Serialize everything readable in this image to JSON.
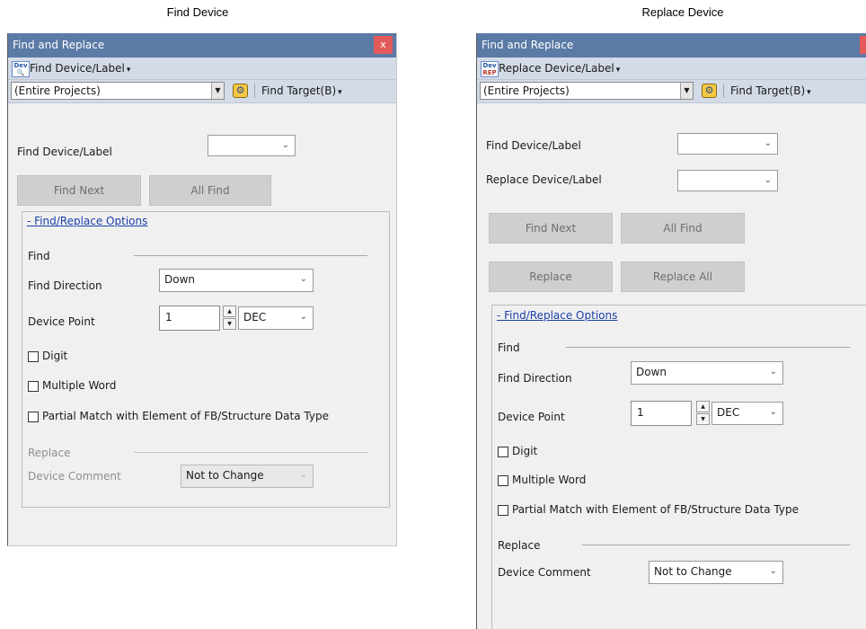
{
  "captions": {
    "left": "Find Device",
    "right": "Replace Device"
  },
  "find_panel": {
    "title": "Find and Replace",
    "close_label": "x",
    "mode_label": "Find Device/Label",
    "scope_value": "(Entire Projects)",
    "target_label": "Find Target(B)",
    "find_field_label": "Find Device/Label",
    "find_field_value": "",
    "find_next_label": "Find Next",
    "all_find_label": "All Find",
    "options_link": "- Find/Replace Options",
    "find_section": "Find",
    "direction_label": "Find Direction",
    "direction_value": "Down",
    "device_point_label": "Device Point",
    "device_point_value": "1",
    "radix_value": "DEC",
    "digit_label": "Digit",
    "multiple_word_label": "Multiple Word",
    "partial_match_label": "Partial Match with Element of FB/Structure Data Type",
    "replace_section": "Replace",
    "device_comment_label": "Device Comment",
    "device_comment_value": "Not to Change"
  },
  "replace_panel": {
    "title": "Find and Replace",
    "mode_label": "Replace Device/Label",
    "scope_value": "(Entire Projects)",
    "target_label": "Find Target(B)",
    "find_field_label": "Find Device/Label",
    "find_field_value": "",
    "replace_field_label": "Replace Device/Label",
    "replace_field_value": "",
    "find_next_label": "Find Next",
    "all_find_label": "All Find",
    "replace_label": "Replace",
    "replace_all_label": "Replace All",
    "options_link": "- Find/Replace Options",
    "find_section": "Find",
    "direction_label": "Find Direction",
    "direction_value": "Down",
    "device_point_label": "Device Point",
    "device_point_value": "1",
    "radix_value": "DEC",
    "digit_label": "Digit",
    "multiple_word_label": "Multiple Word",
    "partial_match_label": "Partial Match with Element of FB/Structure Data Type",
    "replace_section": "Replace",
    "device_comment_label": "Device Comment",
    "device_comment_value": "Not to Change"
  },
  "icons": {
    "mode_find": "device-find-icon",
    "mode_replace": "device-replace-icon",
    "target": "find-target-icon",
    "dropdown": "chevron-down-icon"
  }
}
